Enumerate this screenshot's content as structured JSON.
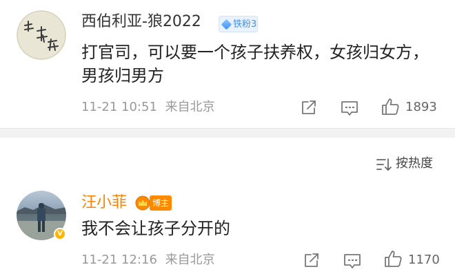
{
  "comments": [
    {
      "username": "西伯利亚-狼2022",
      "badge": "铁粉3",
      "content": "打官司，可以要一个孩子扶养权，女孩归女方，男孩归男方",
      "date": "11-21 10:51",
      "location": "来自北京",
      "likes": "1893",
      "avatar_text": "菜 专 匣"
    },
    {
      "username": "汪小菲",
      "badge": "博主",
      "content": "我不会让孩子分开的",
      "date": "11-21 12:16",
      "location": "来自北京",
      "likes": "1170"
    }
  ],
  "sort": {
    "label": "按热度"
  },
  "icons": {
    "share": "share-icon",
    "comment": "comment-icon",
    "like": "like-icon",
    "sort": "sort-icon",
    "crown": "crown-icon",
    "diamond": "diamond-icon",
    "verified": "verified-icon"
  },
  "colors": {
    "host_name": "#ff8200",
    "host_badge": "#ff8a00",
    "fan_badge_text": "#4a90e2",
    "meta": "#999999"
  }
}
